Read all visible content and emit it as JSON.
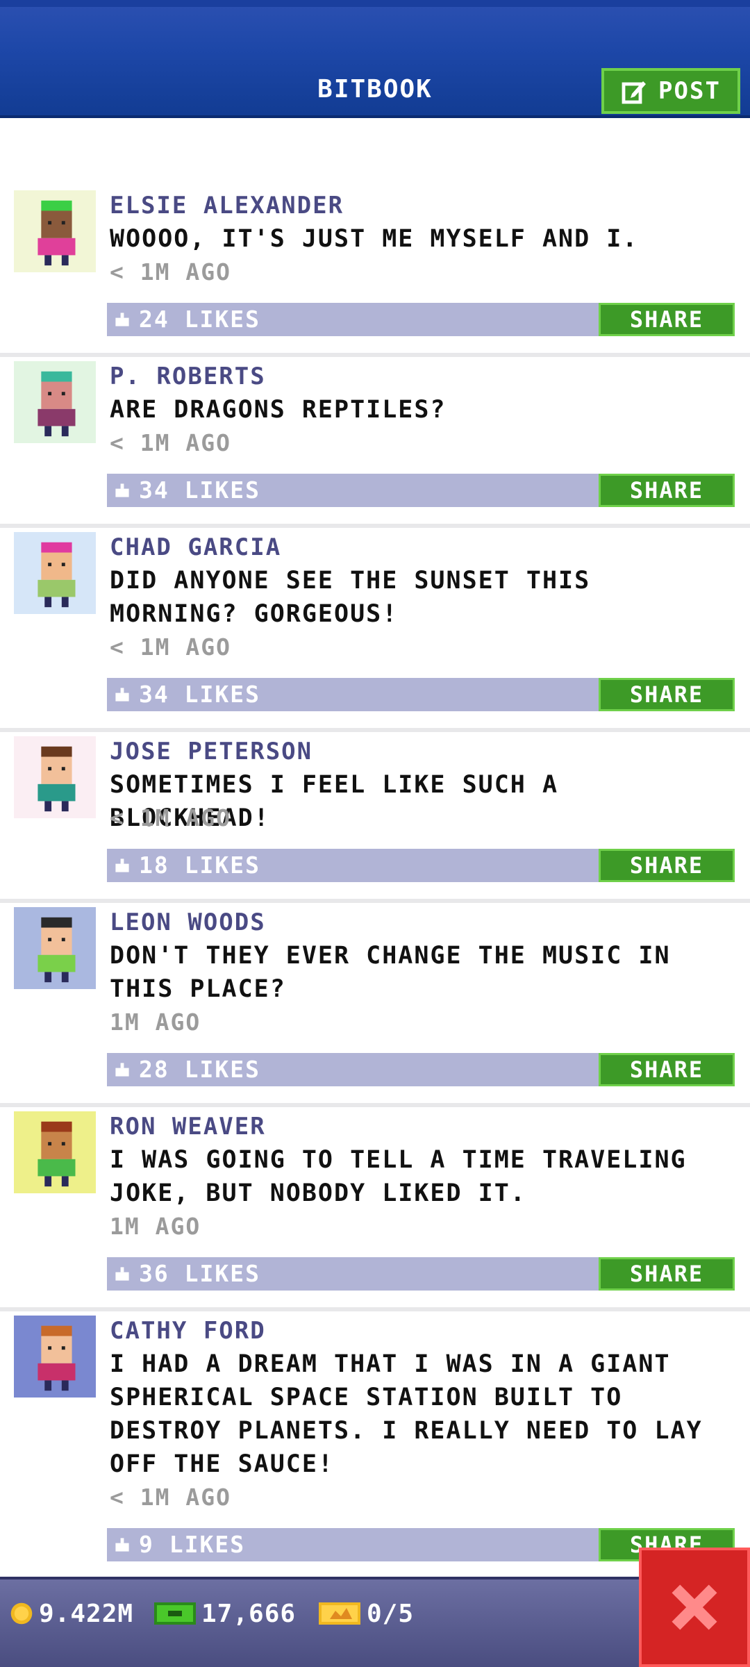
{
  "header": {
    "title": "BITBOOK",
    "post_label": "POST"
  },
  "posts": [
    {
      "name": "ELSIE ALEXANDER",
      "lines": [
        "WOOOO, IT'S JUST ME MYSELF AND I."
      ],
      "time": "< 1M AGO",
      "likes": "24 LIKES",
      "share": "SHARE",
      "avatar_bg": "#f2f6d6",
      "skin": "#8a5a3c",
      "hair": "#3bcf45",
      "shirt": "#e0409a"
    },
    {
      "name": "P. ROBERTS",
      "lines": [
        "ARE DRAGONS REPTILES?"
      ],
      "time": "< 1M AGO",
      "likes": "34 LIKES",
      "share": "SHARE",
      "avatar_bg": "#e2f5e2",
      "skin": "#d88a86",
      "hair": "#3ab89c",
      "shirt": "#8a3a6a"
    },
    {
      "name": "CHAD GARCIA",
      "lines": [
        "DID ANYONE SEE THE SUNSET THIS",
        "MORNING? GORGEOUS!"
      ],
      "time": "< 1M AGO",
      "likes": "34 LIKES",
      "share": "SHARE",
      "avatar_bg": "#d6e6f8",
      "skin": "#f0b88a",
      "hair": "#e03aa0",
      "shirt": "#9ac86a"
    },
    {
      "name": "JOSE PETERSON",
      "lines": [
        "SOMETIMES I FEEL LIKE SUCH A BLOCKHEAD!"
      ],
      "time": "< 1M AGO",
      "likes": "18 LIKES",
      "share": "SHARE",
      "avatar_bg": "#fbeef3",
      "skin": "#f2c09a",
      "hair": "#6a3a1e",
      "shirt": "#2a9a8a"
    },
    {
      "name": "LEON WOODS",
      "lines": [
        "DON'T THEY EVER CHANGE THE MUSIC IN",
        "THIS PLACE?"
      ],
      "time": "1M AGO",
      "likes": "28 LIKES",
      "share": "SHARE",
      "avatar_bg": "#aab8e0",
      "skin": "#f2c09a",
      "hair": "#2a2a2a",
      "shirt": "#7ad04a"
    },
    {
      "name": "RON WEAVER",
      "lines": [
        "I WAS GOING TO TELL A TIME TRAVELING",
        "JOKE, BUT NOBODY LIKED IT."
      ],
      "time": "1M AGO",
      "likes": "36 LIKES",
      "share": "SHARE",
      "avatar_bg": "#eef08a",
      "skin": "#c8844a",
      "hair": "#9a3a1a",
      "shirt": "#4aba4a"
    },
    {
      "name": "CATHY FORD",
      "lines": [
        "I HAD A DREAM THAT I WAS IN A GIANT",
        "SPHERICAL SPACE STATION BUILT TO",
        "DESTROY PLANETS. I REALLY NEED TO LAY",
        "OFF THE SAUCE!"
      ],
      "time": "< 1M AGO",
      "likes": "9 LIKES",
      "share": "SHARE",
      "avatar_bg": "#7a88d0",
      "skin": "#f2c09a",
      "hair": "#c86a2a",
      "shirt": "#c8306a"
    }
  ],
  "footer": {
    "coins": "9.422M",
    "bux": "17,666",
    "tickets": "0/5"
  },
  "colors": {
    "header_blue": "#1d47a8",
    "share_green": "#3d9a27",
    "likes_bar": "#b1b4d6",
    "close_red": "#d52424"
  }
}
